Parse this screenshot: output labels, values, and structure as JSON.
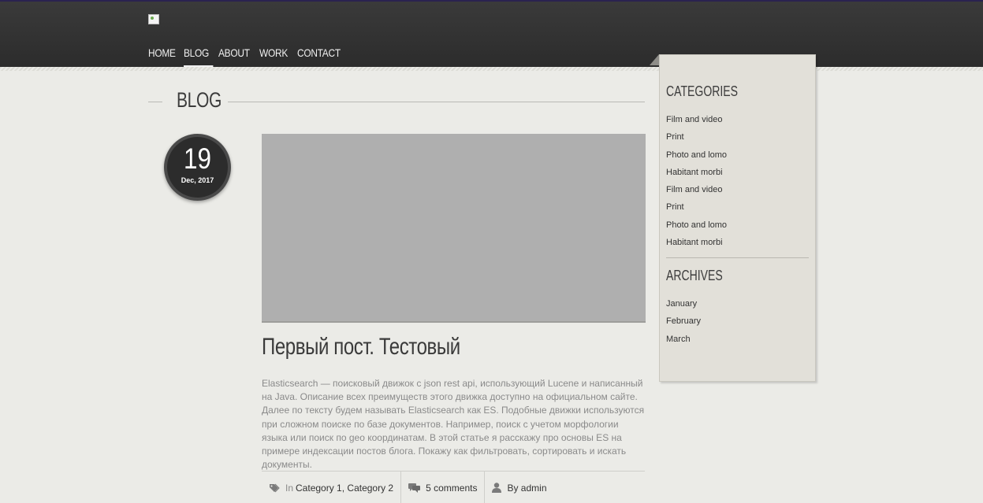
{
  "nav": {
    "items": [
      {
        "label": "HOME"
      },
      {
        "label": "BLOG"
      },
      {
        "label": "ABOUT"
      },
      {
        "label": "WORK"
      },
      {
        "label": "CONTACT"
      }
    ],
    "active": "BLOG"
  },
  "page": {
    "title": "BLOG"
  },
  "post": {
    "day": "19",
    "month_year": "Dec, 2017",
    "title": "Первый пост. Тестовый",
    "excerpt": "Elasticsearch — поисковый движок с json rest api, использующий Lucene и написанный на Java. Описание всех преимуществ этого движка доступно на официальном сайте. Далее по тексту будем называть Elasticsearch как ES. Подобные движки используются при сложном поиске по базе документов. Например, поиск с учетом морфологии языка или поиск по geo координатам. В этой статье я расскажу про основы ES на примере индексации постов блога. Покажу как фильтровать, сортировать и искать документы.",
    "meta": {
      "in_label": "In",
      "categories": [
        "Category 1",
        "Category 2"
      ],
      "category_separator": ",",
      "comments": "5 comments",
      "author": "By admin"
    }
  },
  "sidebar": {
    "categories_title": "CATEGORIES",
    "categories": [
      "Film and video",
      "Print",
      "Photo and lomo",
      "Habitant morbi",
      "Film and video",
      "Print",
      "Photo and lomo",
      "Habitant morbi"
    ],
    "archives_title": "ARCHIVES",
    "archives": [
      "January",
      "February",
      "March"
    ]
  },
  "icons": {
    "logo": "broken-image-icon",
    "category": "tag-icon",
    "comments": "comments-icon",
    "author": "user-icon"
  },
  "colors": {
    "header_bg": "#333333",
    "page_bg": "#ebebe7",
    "sidebar_bg": "#e2e0d9",
    "image_placeholder": "#afafaf",
    "date_badge": "#2c2c2c"
  }
}
